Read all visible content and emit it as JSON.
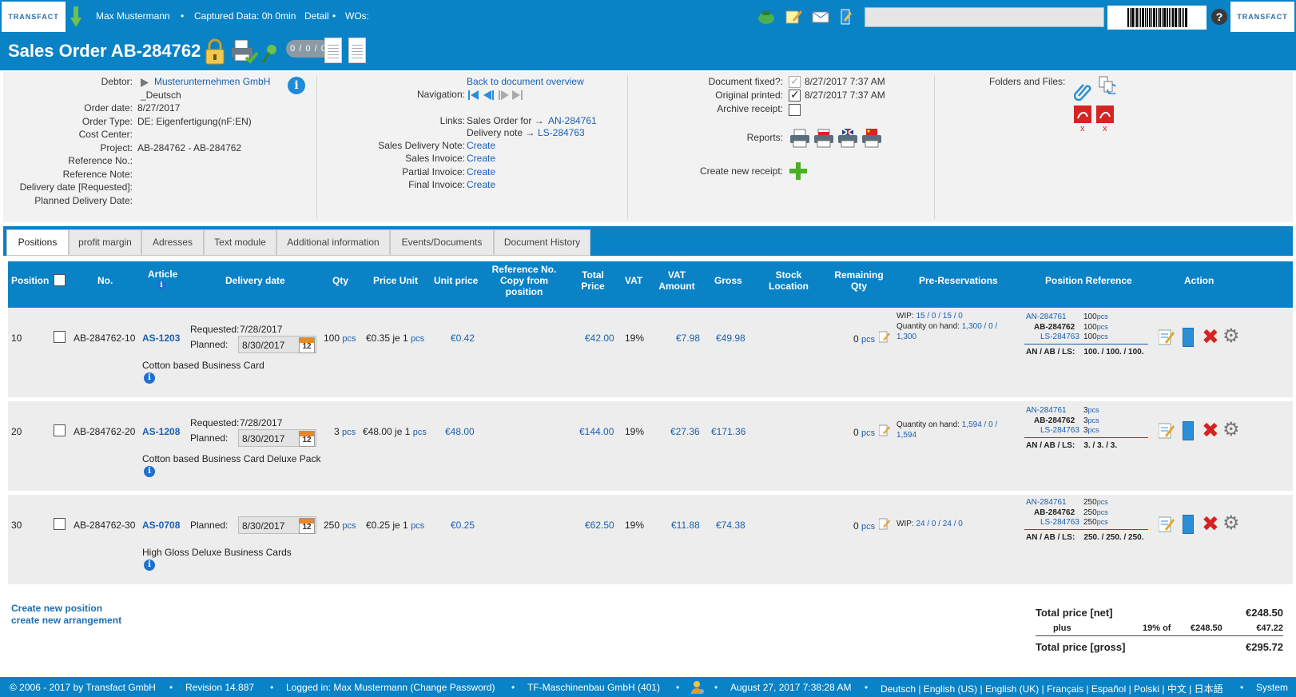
{
  "topbar": {
    "logo": "TRANSFACT",
    "user": "Max Mustermann",
    "captured": "Captured Data: 0h 0min",
    "detail": "Detail",
    "wos": "WOs:",
    "help": "?"
  },
  "title": {
    "text": "Sales Order AB-284762",
    "counter": "0 / 0 / 0"
  },
  "debtor": {
    "labels": {
      "debtor": "Debtor:",
      "order_date": "Order date:",
      "order_type": "Order Type:",
      "cost_center": "Cost Center:",
      "project": "Project:",
      "reference_no": "Reference No.:",
      "reference_note": "Reference Note:",
      "delivery_requested": "Delivery date [Requested]:",
      "planned_delivery": "Planned Delivery Date:"
    },
    "name": "Musterunternehmen GmbH",
    "language": "_Deutsch",
    "order_date": "8/27/2017",
    "order_type": "DE: Eigenfertigung(nF:EN)",
    "project": "AB-284762 - AB-284762"
  },
  "nav": {
    "back_link": "Back to document overview",
    "navigation_label": "Navigation:",
    "links_label": "Links:",
    "link1_text": "Sales Order for →",
    "link1_value": "AN-284761",
    "link2_text": "Delivery note →",
    "link2_value": "LS-284763",
    "sales_delivery_note": "Sales Delivery Note:",
    "sales_invoice": "Sales Invoice:",
    "partial_invoice": "Partial Invoice:",
    "final_invoice": "Final Invoice:",
    "create": "Create"
  },
  "docstatus": {
    "fixed_label": "Document fixed?:",
    "fixed_date": "8/27/2017 7:37 AM",
    "printed_label": "Original printed:",
    "printed_date": "8/27/2017 7:37 AM",
    "archive_label": "Archive receipt:",
    "reports_label": "Reports:",
    "create_receipt_label": "Create new receipt:"
  },
  "folders": {
    "label": "Folders and Files:",
    "delete_mark": "x"
  },
  "tabs": [
    "Positions",
    "profit margin",
    "Adresses",
    "Text module",
    "Additional information",
    "Events/Documents",
    "Document History"
  ],
  "columns": {
    "position": "Position",
    "no": "No.",
    "article": "Article",
    "delivery_date": "Delivery date",
    "qty": "Qty",
    "price_unit": "Price Unit",
    "unit_price": "Unit price",
    "ref_no_l1": "Reference No.",
    "ref_no_l2": "Copy from",
    "ref_no_l3": "position",
    "total_price_l1": "Total",
    "total_price_l2": "Price",
    "vat": "VAT",
    "vat_amount_l1": "VAT",
    "vat_amount_l2": "Amount",
    "gross": "Gross",
    "stock_l1": "Stock",
    "stock_l2": "Location",
    "remaining_l1": "Remaining",
    "remaining_l2": "Qty",
    "pre_reservations": "Pre-Reservations",
    "position_reference": "Position Reference",
    "action": "Action"
  },
  "rows": [
    {
      "position": "10",
      "no": "AB-284762-10",
      "article": "AS-1203",
      "requested_label": "Requested:",
      "requested": "7/28/2017",
      "planned_label": "Planned:",
      "planned": "8/30/2017",
      "cal_day": "12",
      "qty": "100",
      "qty_unit": "pcs",
      "price_unit": "€0.35 je 1",
      "price_unit_unit": "pcs",
      "unit_price": "€0.42",
      "total_price": "€42.00",
      "vat": "19%",
      "vat_amount": "€7.98",
      "gross": "€49.98",
      "remaining": "0",
      "remaining_unit": "pcs",
      "description": "Cotton based Business Card",
      "wip_label": "WIP:",
      "wip": "15 / 0 / 15 / 0",
      "onhand_label": "Quantity on hand:",
      "onhand": "1,300 / 0 /",
      "onhand2": "1,300",
      "ref_an": "AN-284761",
      "ref_an_qty": "100",
      "ref_ab": "AB-284762",
      "ref_ab_qty": "100",
      "ref_ls": "LS-284763",
      "ref_ls_qty": "100",
      "ref_unit": "pcs",
      "ref_summary_label": "AN / AB / LS:",
      "ref_summary": "100. / 100. / 100."
    },
    {
      "position": "20",
      "no": "AB-284762-20",
      "article": "AS-1208",
      "requested_label": "Requested:",
      "requested": "7/28/2017",
      "planned_label": "Planned:",
      "planned": "8/30/2017",
      "cal_day": "12",
      "qty": "3",
      "qty_unit": "pcs",
      "price_unit": "€48.00 je 1",
      "price_unit_unit": "pcs",
      "unit_price": "€48.00",
      "total_price": "€144.00",
      "vat": "19%",
      "vat_amount": "€27.36",
      "gross": "€171.36",
      "remaining": "0",
      "remaining_unit": "pcs",
      "description": "Cotton based Business Card Deluxe Pack",
      "onhand_label": "Quantity on hand:",
      "onhand": "1,594 / 0 /",
      "onhand2": "1,594",
      "ref_an": "AN-284761",
      "ref_an_qty": "3",
      "ref_ab": "AB-284762",
      "ref_ab_qty": "3",
      "ref_ls": "LS-284763",
      "ref_ls_qty": "3",
      "ref_unit": "pcs",
      "ref_summary_label": "AN / AB / LS:",
      "ref_summary": "3. / 3. / 3."
    },
    {
      "position": "30",
      "no": "AB-284762-30",
      "article": "AS-0708",
      "planned_label": "Planned:",
      "planned": "8/30/2017",
      "cal_day": "12",
      "qty": "250",
      "qty_unit": "pcs",
      "price_unit": "€0.25 je 1",
      "price_unit_unit": "pcs",
      "unit_price": "€0.25",
      "total_price": "€62.50",
      "vat": "19%",
      "vat_amount": "€11.88",
      "gross": "€74.38",
      "remaining": "0",
      "remaining_unit": "pcs",
      "description": "High Gloss Deluxe Business Cards",
      "wip_label": "WIP:",
      "wip": "24 / 0 / 24 / 0",
      "ref_an": "AN-284761",
      "ref_an_qty": "250",
      "ref_ab": "AB-284762",
      "ref_ab_qty": "250",
      "ref_ls": "LS-284763",
      "ref_ls_qty": "250",
      "ref_unit": "pcs",
      "ref_summary_label": "AN / AB / LS:",
      "ref_summary": "250. / 250. / 250."
    }
  ],
  "actions": {
    "create_position": "Create new position",
    "create_arrangement": "create new arrangement"
  },
  "totals": {
    "net_label": "Total price [net]",
    "net": "€248.50",
    "plus_label": "plus",
    "vat_rate": "19% of",
    "vat_base": "€248.50",
    "vat_value": "€47.22",
    "gross_label": "Total price [gross]",
    "gross": "€295.72"
  },
  "footer": {
    "copyright": "© 2006 - 2017 by Transfact GmbH",
    "revision": "Revision  14.887",
    "logged_in": "Logged in: Max Mustermann (Change Password)",
    "company": "TF-Maschinenbau GmbH (401)",
    "datetime": "August 27, 2017 7:38:28 AM",
    "languages": "Deutsch | English (US) | English (UK) | Français | Español | Polski | 中文 | 日本語",
    "system": "System"
  },
  "colors": {
    "brand_blue": "#0a82c6",
    "link_blue": "#1a5fb4",
    "row_bg": "#ededed",
    "delete_red": "#d62222"
  }
}
